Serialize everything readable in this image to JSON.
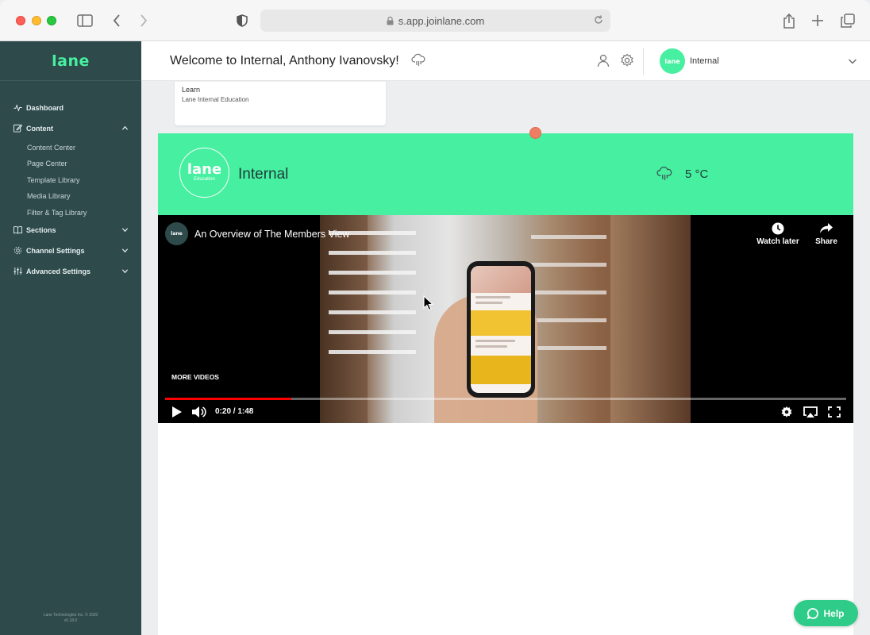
{
  "browser": {
    "url": "s.app.joinlane.com"
  },
  "sidebar": {
    "logo": "lane",
    "sections": [
      {
        "label": "Dashboard",
        "icon": "activity-icon",
        "expandable": false
      },
      {
        "label": "Content",
        "icon": "edit-icon",
        "expandable": true,
        "expanded": true
      },
      {
        "label": "Sections",
        "icon": "book-icon",
        "expandable": true,
        "expanded": false
      },
      {
        "label": "Channel Settings",
        "icon": "gear-icon",
        "expandable": true,
        "expanded": false
      },
      {
        "label": "Advanced Settings",
        "icon": "sliders-icon",
        "expandable": true,
        "expanded": false
      }
    ],
    "content_items": [
      "Content Center",
      "Page Center",
      "Template Library",
      "Media Library",
      "Filter & Tag Library"
    ],
    "footer_line1": "Lane Technologies Inc. © 2020",
    "footer_line2": "v5.18.0"
  },
  "header": {
    "welcome": "Welcome to Internal, Anthony Ivanovsky!",
    "avatar_text": "lane",
    "channel_name": "Internal"
  },
  "learn_card": {
    "title": "Learn",
    "subtitle": "Lane Internal Education"
  },
  "banner": {
    "logo_word": "lane",
    "logo_sub": "Education",
    "title": "Internal",
    "temperature": "5 °C",
    "background_color": "#46f0a0"
  },
  "video": {
    "channel_avatar": "lane",
    "title": "An Overview of The Members View",
    "watch_later": "Watch later",
    "share": "Share",
    "more_videos": "MORE VIDEOS",
    "time": "0:20 / 1:48",
    "progress": 0.185
  },
  "help": {
    "label": "Help"
  }
}
